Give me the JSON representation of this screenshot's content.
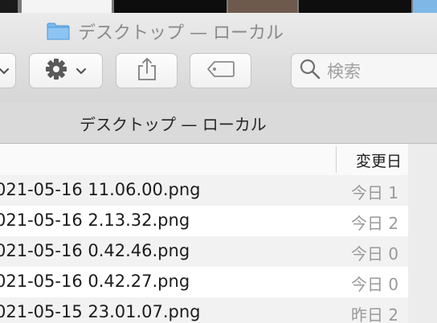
{
  "window": {
    "title": "デスクトップ — ローカル"
  },
  "toolbar": {
    "search_placeholder": "検索"
  },
  "pathbar": {
    "label": "デスクトップ — ローカル"
  },
  "list": {
    "date_column": "変更日",
    "rows": [
      {
        "name": "021-05-16 11.06.00.png",
        "date": "今日 1"
      },
      {
        "name": "021-05-16 2.13.32.png",
        "date": "今日 2"
      },
      {
        "name": "021-05-16 0.42.46.png",
        "date": "今日 0"
      },
      {
        "name": "021-05-16 0.42.27.png",
        "date": "今日 0"
      },
      {
        "name": "021-05-15 23.01.07.png",
        "date": "昨日 2"
      }
    ]
  },
  "colors": {
    "accent_folder": "#5aa8e8",
    "selected_row_bg": "#f2f2f2"
  },
  "icons": [
    "folder-icon",
    "chevron-down-icon",
    "gear-icon",
    "share-icon",
    "tag-icon",
    "search-icon"
  ]
}
